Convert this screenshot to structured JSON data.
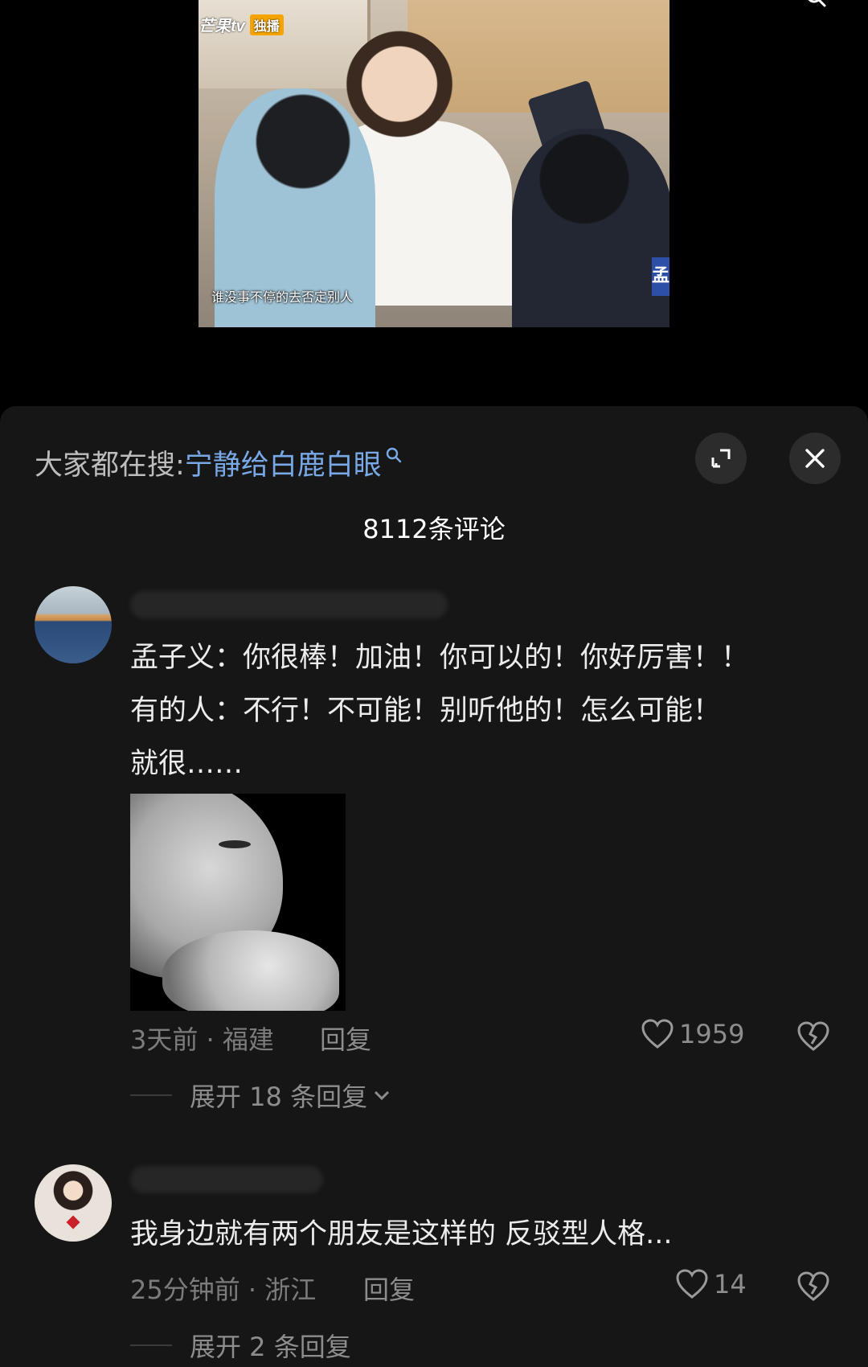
{
  "video": {
    "logo_text": "芒果tv",
    "badge_text": "独播",
    "subtitle": "谁没事不停的去否定别人",
    "corner_mark": "孟"
  },
  "sheet": {
    "search_label": "大家都在搜:",
    "search_keyword": "宁静给白鹿白眼",
    "comment_count": "8112条评论"
  },
  "comments": [
    {
      "line1": "孟子义：你很棒！加油！你可以的！你好厉害！！",
      "line2": "有的人：不行！不可能！别听他的！怎么可能！",
      "line3": "就很……",
      "meta": "3天前 · 福建",
      "reply_label": "回复",
      "likes": "1959",
      "expand_label": "展开 18 条回复"
    },
    {
      "line1": "我身边就有两个朋友是这样的 反驳型人格...",
      "meta": "25分钟前 · 浙江",
      "reply_label": "回复",
      "likes": "14",
      "expand_label": "展开 2 条回复"
    }
  ],
  "icons": {
    "search": "search-icon",
    "expand": "expand-icon",
    "close": "close-icon",
    "like": "heart-icon",
    "dislike": "broken-heart-icon",
    "chevron": "chevron-down-icon"
  },
  "colors": {
    "sheet_bg": "#161616",
    "keyword": "#79a8e6",
    "meta": "#7c7c7c"
  }
}
